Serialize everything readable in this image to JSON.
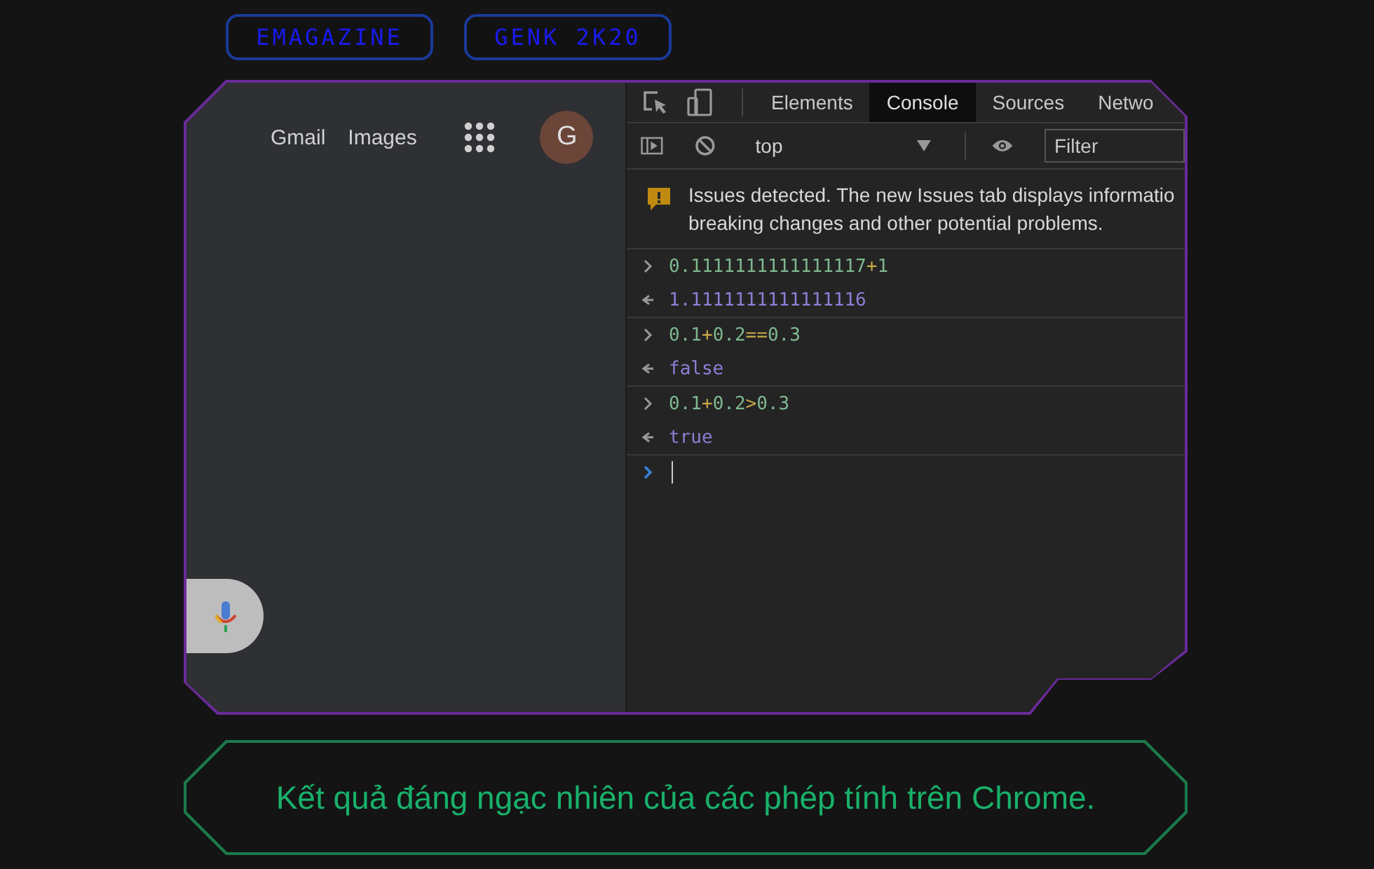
{
  "header_buttons": [
    "EMAGAZINE",
    "GENK 2K20"
  ],
  "browser": {
    "links": [
      "Gmail",
      "Images"
    ],
    "avatar": "G"
  },
  "devtools": {
    "tabs": [
      {
        "label": "Elements",
        "selected": false
      },
      {
        "label": "Console",
        "selected": true
      },
      {
        "label": "Sources",
        "selected": false
      },
      {
        "label": "Netwo",
        "selected": false
      }
    ],
    "context": "top",
    "filter": {
      "placeholder": "Filter"
    },
    "issues_message": "Issues detected. The new Issues tab displays informatio breaking changes and other potential problems.",
    "console": [
      {
        "kind": "input",
        "parts": [
          {
            "kind": "number",
            "text": "0.1111111111111117"
          },
          {
            "kind": "operator",
            "text": "+"
          },
          {
            "kind": "number",
            "text": "1"
          }
        ]
      },
      {
        "kind": "output",
        "parts": [
          {
            "kind": "value",
            "text": "1.1111111111111116"
          }
        ]
      },
      {
        "kind": "input",
        "parts": [
          {
            "kind": "number",
            "text": "0.1"
          },
          {
            "kind": "operator",
            "text": "+"
          },
          {
            "kind": "number",
            "text": "0.2"
          },
          {
            "kind": "operator",
            "text": "=="
          },
          {
            "kind": "number",
            "text": "0.3"
          }
        ]
      },
      {
        "kind": "output",
        "parts": [
          {
            "kind": "value",
            "text": "false"
          }
        ]
      },
      {
        "kind": "input",
        "parts": [
          {
            "kind": "number",
            "text": "0.1"
          },
          {
            "kind": "operator",
            "text": "+"
          },
          {
            "kind": "number",
            "text": "0.2"
          },
          {
            "kind": "operator",
            "text": ">"
          },
          {
            "kind": "number",
            "text": "0.3"
          }
        ]
      },
      {
        "kind": "output",
        "parts": [
          {
            "kind": "value",
            "text": "true"
          }
        ]
      }
    ]
  },
  "caption": "Kết quả đáng ngạc nhiên của các phép tính trên Chrome."
}
